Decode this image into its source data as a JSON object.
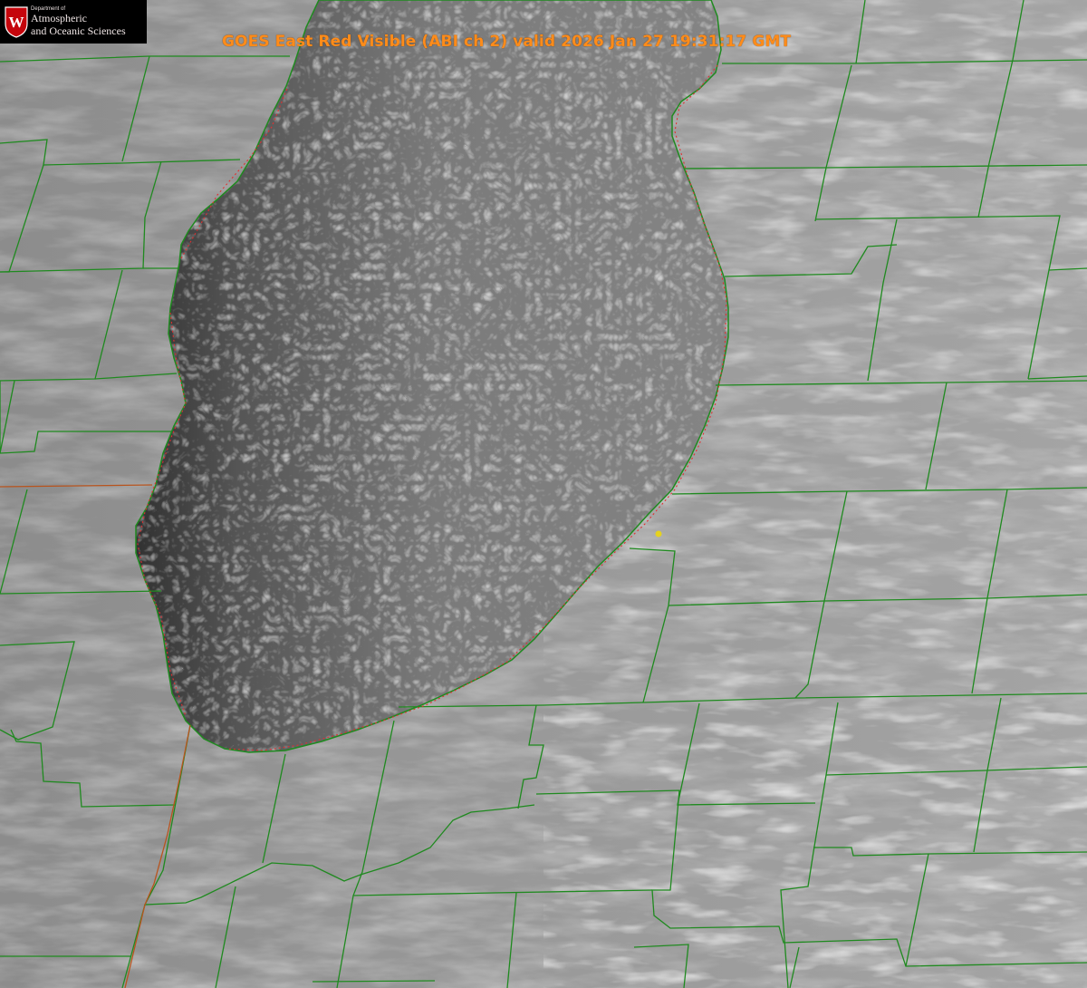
{
  "title": "GOES East Red Visible (ABI ch 2) valid 2026 Jan 27 19:31:17 GMT",
  "logo": {
    "department": "Department of",
    "line1": "Atmospheric",
    "line2": "and Oceanic Sciences",
    "shield_letter": "W",
    "colors": {
      "shield": "#c5050c",
      "text": "#f0e6e6",
      "background": "#000000"
    }
  },
  "colors": {
    "title": "#ff8c1a",
    "county_borders": "#1f8a1f",
    "state_border": "#b8541e",
    "coastline_dotted": "#e03030",
    "marker": "#e6d21e",
    "land": "#9a9a9a",
    "lake": "#707070"
  },
  "icons": [
    "uw-crest-icon",
    "location-marker-icon"
  ]
}
